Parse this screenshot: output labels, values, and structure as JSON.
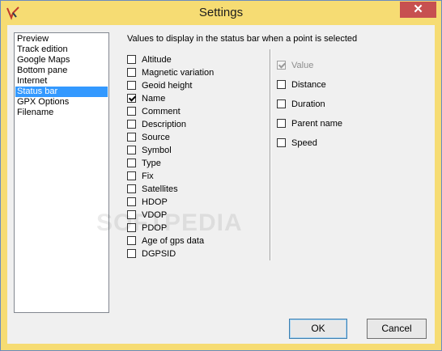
{
  "window": {
    "title": "Settings",
    "close_glyph": "✕"
  },
  "nav": {
    "items": [
      {
        "label": "Preview",
        "selected": false
      },
      {
        "label": "Track edition",
        "selected": false
      },
      {
        "label": "Google Maps",
        "selected": false
      },
      {
        "label": "Bottom pane",
        "selected": false
      },
      {
        "label": "Internet",
        "selected": false
      },
      {
        "label": "Status bar",
        "selected": true
      },
      {
        "label": "GPX Options",
        "selected": false
      },
      {
        "label": "Filename",
        "selected": false
      }
    ]
  },
  "panel": {
    "heading": "Values to display in the status bar when a point is selected",
    "left_options": [
      {
        "label": "Altitude",
        "checked": false
      },
      {
        "label": "Magnetic variation",
        "checked": false
      },
      {
        "label": "Geoid height",
        "checked": false
      },
      {
        "label": "Name",
        "checked": true
      },
      {
        "label": "Comment",
        "checked": false
      },
      {
        "label": "Description",
        "checked": false
      },
      {
        "label": "Source",
        "checked": false
      },
      {
        "label": "Symbol",
        "checked": false
      },
      {
        "label": "Type",
        "checked": false
      },
      {
        "label": "Fix",
        "checked": false
      },
      {
        "label": "Satellites",
        "checked": false
      },
      {
        "label": "HDOP",
        "checked": false
      },
      {
        "label": "VDOP",
        "checked": false
      },
      {
        "label": "PDOP",
        "checked": false
      },
      {
        "label": "Age of gps data",
        "checked": false
      },
      {
        "label": "DGPSID",
        "checked": false
      }
    ],
    "right_options": [
      {
        "label": "Value",
        "checked": true,
        "disabled": true
      },
      {
        "label": "Distance",
        "checked": false,
        "disabled": false
      },
      {
        "label": "Duration",
        "checked": false,
        "disabled": false
      },
      {
        "label": "Parent name",
        "checked": false,
        "disabled": false
      },
      {
        "label": "Speed",
        "checked": false,
        "disabled": false
      }
    ]
  },
  "buttons": {
    "ok": "OK",
    "cancel": "Cancel"
  },
  "watermark": "SOFTPEDIA",
  "colors": {
    "titlebar": "#f6dc73",
    "selection": "#3399ff",
    "close": "#c75050"
  }
}
